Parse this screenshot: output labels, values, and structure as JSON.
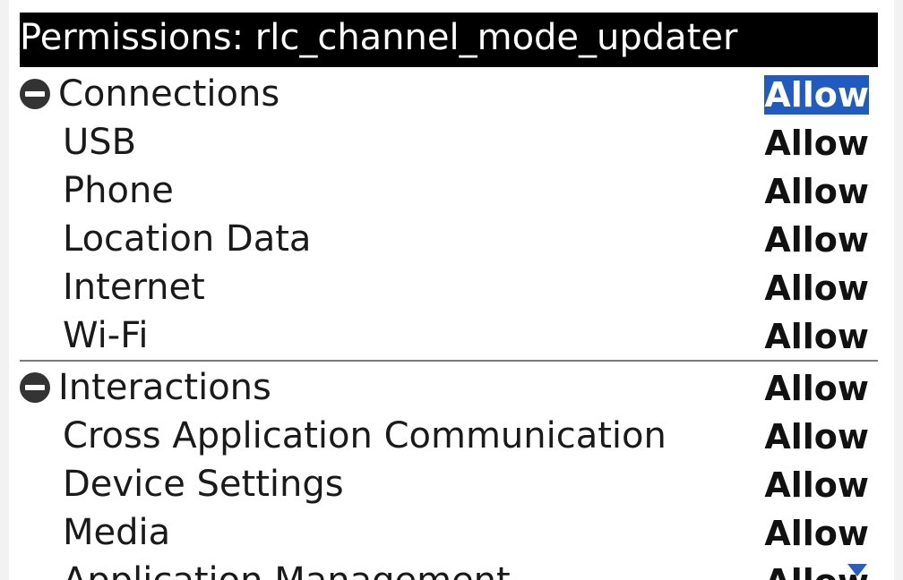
{
  "title": "Permissions: rlc_channel_mode_updater",
  "groups": [
    {
      "label": "Connections",
      "value": "Allow",
      "items": [
        {
          "label": "USB",
          "value": "Allow"
        },
        {
          "label": "Phone",
          "value": "Allow"
        },
        {
          "label": "Location Data",
          "value": "Allow"
        },
        {
          "label": "Internet",
          "value": "Allow"
        },
        {
          "label": "Wi-Fi",
          "value": "Allow"
        }
      ]
    },
    {
      "label": "Interactions",
      "value": "Allow",
      "items": [
        {
          "label": "Cross Application Communication",
          "value": "Allow"
        },
        {
          "label": "Device Settings",
          "value": "Allow"
        },
        {
          "label": "Media",
          "value": "Allow"
        },
        {
          "label": "Application Management",
          "value": "Allow"
        }
      ]
    }
  ],
  "colors": {
    "selection": "#1f5bc1",
    "titlebar": "#000000"
  }
}
